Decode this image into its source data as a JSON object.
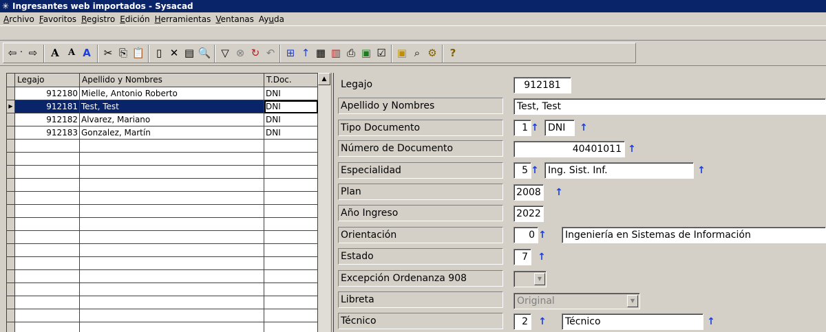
{
  "window": {
    "title": "Ingresantes web importados - Sysacad"
  },
  "menu": [
    {
      "pre": "",
      "u": "A",
      "post": "rchivo"
    },
    {
      "pre": "",
      "u": "F",
      "post": "avoritos"
    },
    {
      "pre": "",
      "u": "R",
      "post": "egistro"
    },
    {
      "pre": "",
      "u": "E",
      "post": "dición"
    },
    {
      "pre": "",
      "u": "H",
      "post": "erramientas"
    },
    {
      "pre": "",
      "u": "V",
      "post": "entanas"
    },
    {
      "pre": "Ay",
      "u": "u",
      "post": "da"
    }
  ],
  "toolbar": {
    "icons": [
      "back-arrow-icon",
      "dropdown-dot-icon",
      "forward-arrow-icon",
      "font-larger-icon",
      "font-smaller-icon",
      "font-style-icon",
      "cut-icon",
      "copy-icon",
      "paste-icon",
      "new-record-icon",
      "delete-record-icon",
      "properties-icon",
      "print-preview-icon",
      "filter-icon",
      "clear-filter-icon",
      "refresh-icon",
      "undo-icon",
      "tree-icon",
      "sort-up-icon",
      "report-icon",
      "columns-icon",
      "printer-icon",
      "export-excel-icon",
      "checkbox-icon",
      "calendar-icon",
      "search-icon",
      "settings-icon",
      "help-icon"
    ]
  },
  "grid": {
    "headers": [
      "Legajo",
      "Apellido y Nombres",
      "T.Doc."
    ],
    "rows": [
      {
        "legajo": "912180",
        "nombre": "Mielle, Antonio Roberto",
        "tdoc": "DNI"
      },
      {
        "legajo": "912181",
        "nombre": "Test, Test",
        "tdoc": "DNI"
      },
      {
        "legajo": "912182",
        "nombre": "Alvarez, Mariano",
        "tdoc": "DNI"
      },
      {
        "legajo": "912183",
        "nombre": "Gonzalez, Martín",
        "tdoc": "DNI"
      }
    ],
    "selected_row": 1
  },
  "form": {
    "legajo": {
      "label": "Legajo",
      "value": "912181"
    },
    "apellido": {
      "label": "Apellido y Nombres",
      "value": "Test, Test"
    },
    "tipo_doc": {
      "label": "Tipo Documento",
      "code": "1",
      "desc": "DNI"
    },
    "nro_doc": {
      "label": "Número de Documento",
      "value": "40401011"
    },
    "especialidad": {
      "label": "Especialidad",
      "code": "5",
      "desc": "Ing. Sist. Inf."
    },
    "plan": {
      "label": "Plan",
      "value": "2008"
    },
    "anio_ingreso": {
      "label": "Año Ingreso",
      "value": "2022"
    },
    "orientacion": {
      "label": "Orientación",
      "code": "0",
      "desc": "Ingeniería en Sistemas de Información"
    },
    "estado": {
      "label": "Estado",
      "value": "7"
    },
    "excepcion": {
      "label": "Excepción Ordenanza 908",
      "value": ""
    },
    "libreta": {
      "label": "Libreta",
      "value": "Original"
    },
    "tecnico": {
      "label": "Técnico",
      "code": "2",
      "desc": "Técnico"
    }
  },
  "colors": {
    "titlebar": "#0a246a",
    "window_bg": "#d4d0c8",
    "lookup_arrow": "#1a3ee0"
  }
}
